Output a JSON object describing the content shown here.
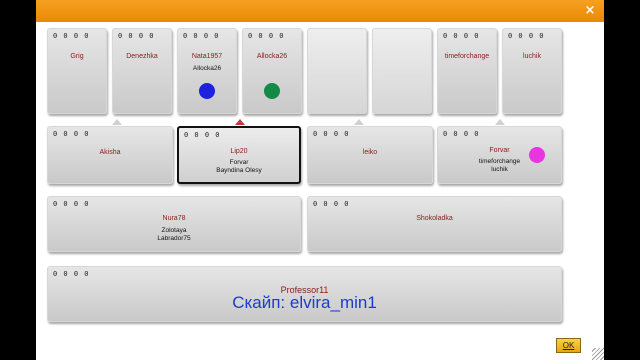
{
  "window": {
    "close_glyph": "×"
  },
  "row1": [
    {
      "score": "0 0 0 0",
      "name": "Grig"
    },
    {
      "score": "0 0 0 0",
      "name": "Denezhka"
    },
    {
      "score": "0 0 0 0",
      "name": "Nata1957",
      "sub": "Allocka26",
      "chip_color": "#1c22e0"
    },
    {
      "score": "0 0 0 0",
      "name": "Allocka26",
      "chip_color": "#138a45"
    },
    {
      "score": "",
      "name": ""
    },
    {
      "score": "",
      "name": ""
    },
    {
      "score": "0 0 0 0",
      "name": "timeforchange"
    },
    {
      "score": "0 0 0 0",
      "name": "luchik"
    }
  ],
  "row2": [
    {
      "score": "0 0 0 0",
      "name": "Akisha"
    },
    {
      "score": "0 0 0 0",
      "name": "Lip20",
      "sub1": "Forvar",
      "sub2": "Bayndina Olesy"
    },
    {
      "score": "0 0 0 0",
      "name": "leiko"
    },
    {
      "score": "0 0 0 0",
      "name": "Forvar",
      "sub1": "timeforchange",
      "sub2": "luchik",
      "chip_color": "#e835e0"
    }
  ],
  "row3": [
    {
      "score": "0 0 0 0",
      "name": "Nura78",
      "sub1": "Zolotaya",
      "sub2": "Labrador75"
    },
    {
      "score": "0 0 0 0",
      "name": "Shokoladka"
    }
  ],
  "row4": {
    "score": "0 0 0 0",
    "name": "Professor11"
  },
  "overlay": {
    "skype_text": "Скайп: elvira_min1"
  },
  "buttons": {
    "ok_label": "OK"
  }
}
